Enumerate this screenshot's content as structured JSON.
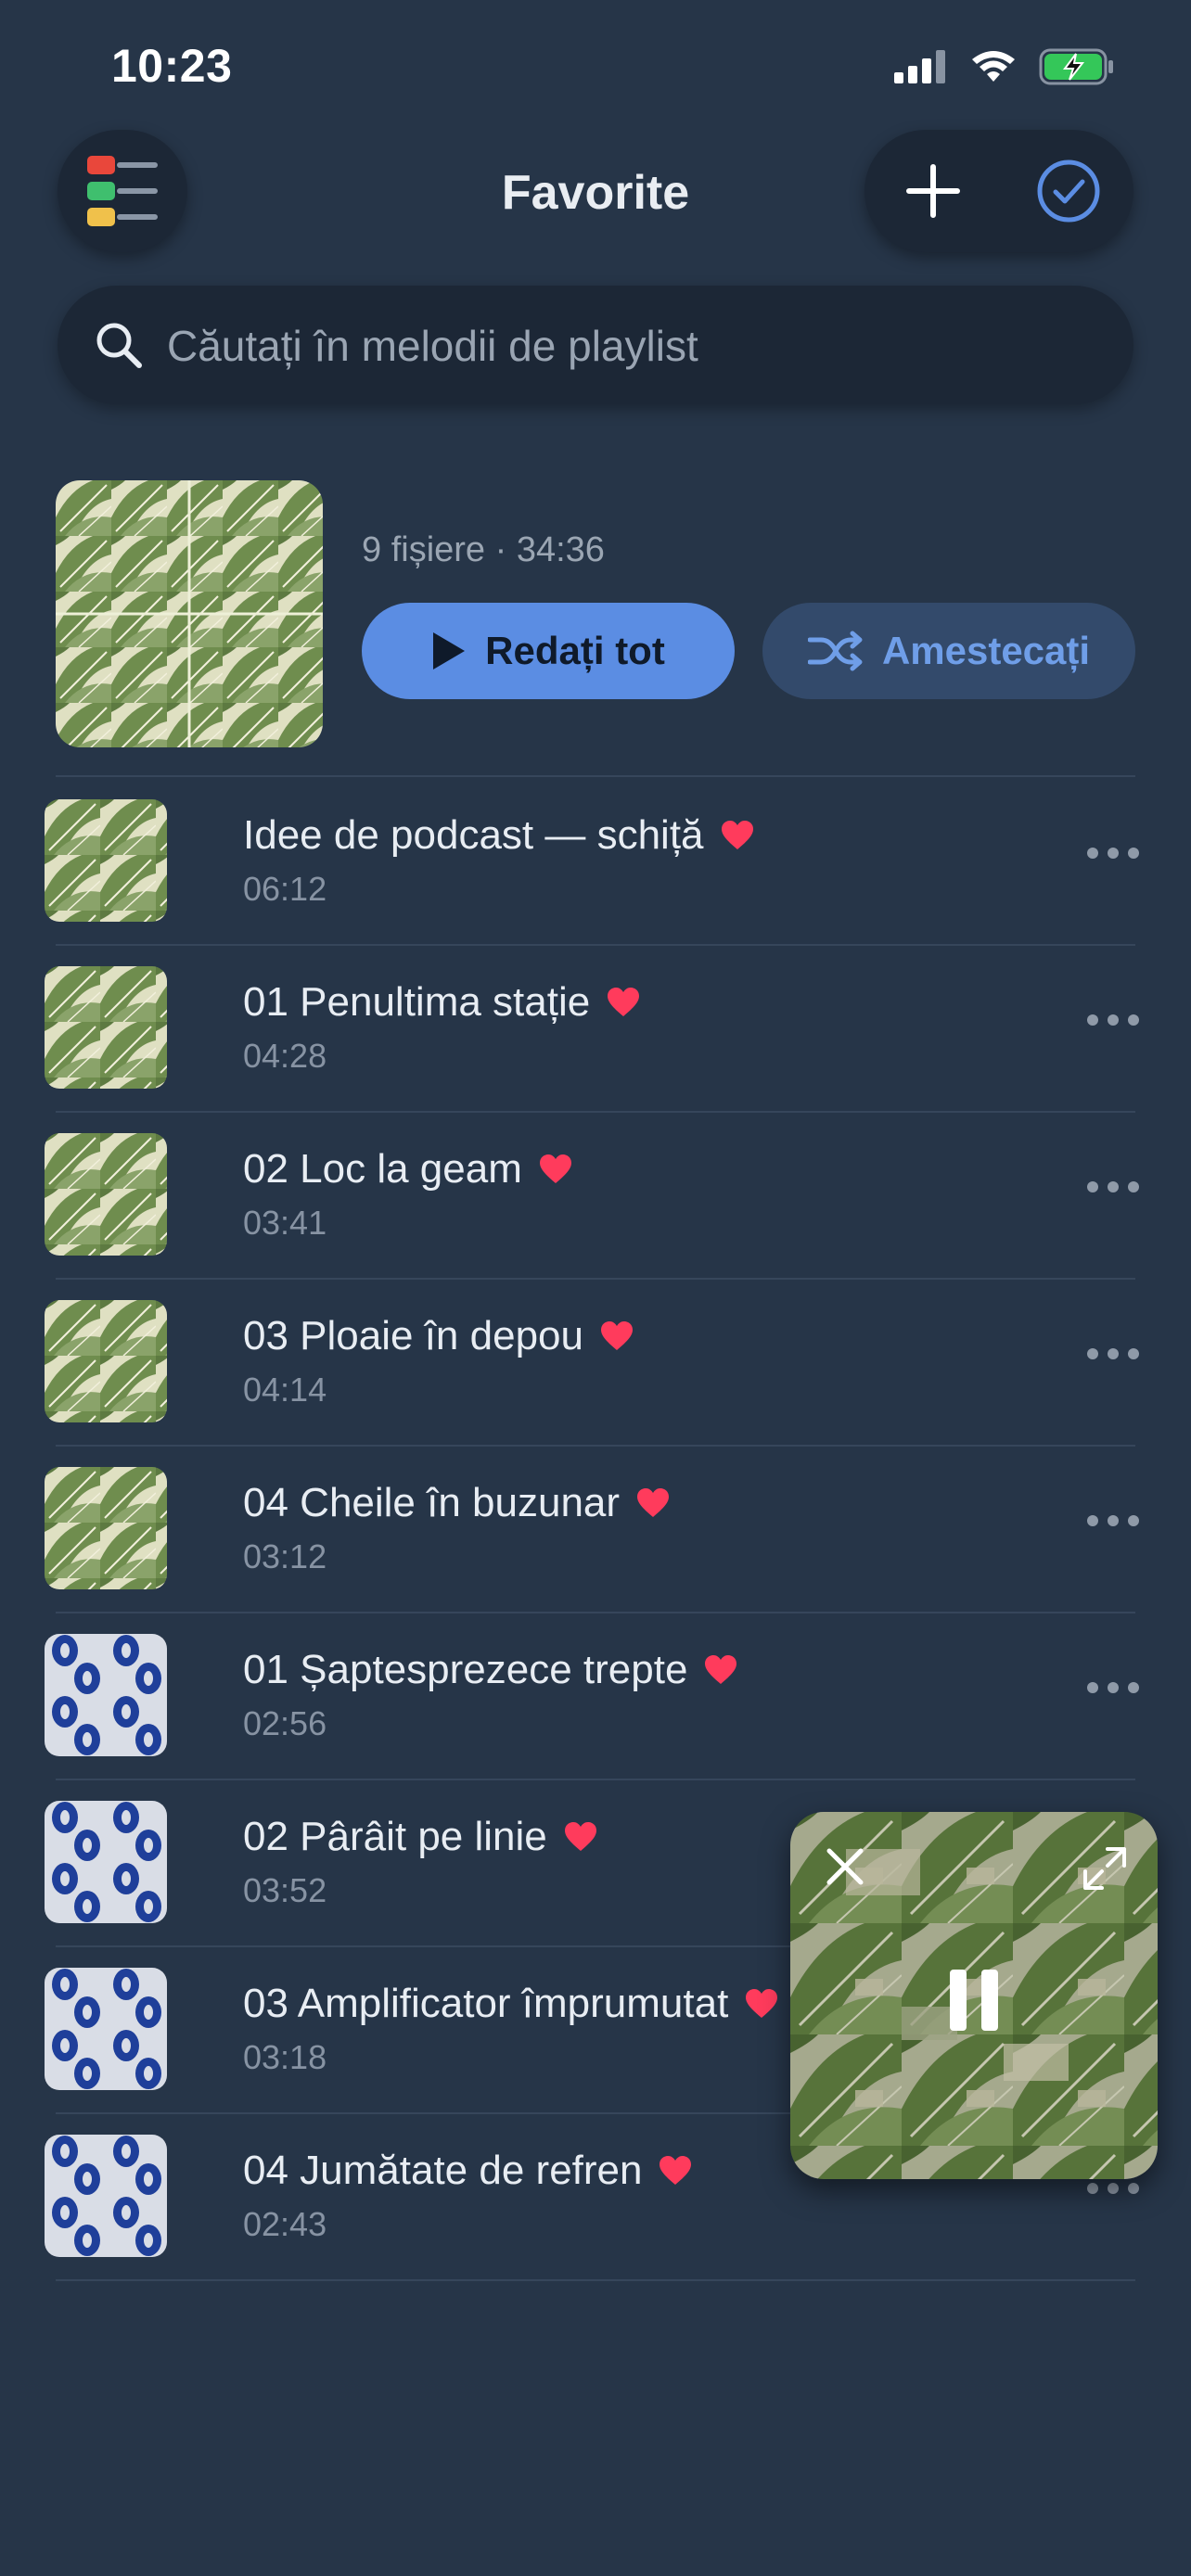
{
  "status_bar": {
    "time": "10:23"
  },
  "header": {
    "title": "Favorite"
  },
  "search": {
    "placeholder": "Căutați în melodii de playlist"
  },
  "playlist": {
    "meta": "9 fișiere · 34:36",
    "play_all_label": "Redați tot",
    "shuffle_label": "Amestecați"
  },
  "tracks": [
    {
      "title": "Idee de podcast — schiță",
      "duration": "06:12",
      "art": "leaf"
    },
    {
      "title": "01 Penultima stație",
      "duration": "04:28",
      "art": "leaf"
    },
    {
      "title": "02 Loc la geam",
      "duration": "03:41",
      "art": "leaf"
    },
    {
      "title": "03 Ploaie în depou",
      "duration": "04:14",
      "art": "leaf"
    },
    {
      "title": "04 Cheile în buzunar",
      "duration": "03:12",
      "art": "leaf"
    },
    {
      "title": "01 Șaptesprezece trepte",
      "duration": "02:56",
      "art": "blue"
    },
    {
      "title": "02 Pârâit pe linie",
      "duration": "03:52",
      "art": "blue"
    },
    {
      "title": "03 Amplificator împrumutat",
      "duration": "03:18",
      "art": "blue"
    },
    {
      "title": "04 Jumătate de refren",
      "duration": "02:43",
      "art": "blue"
    }
  ],
  "colors": {
    "background": "#263548",
    "accent": "#5b8de3",
    "heart": "#ff3b5c",
    "battery": "#34c759"
  }
}
